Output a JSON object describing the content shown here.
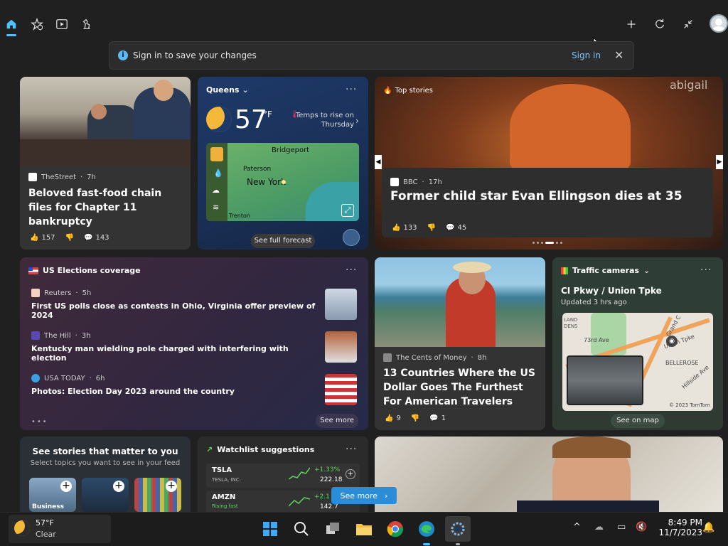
{
  "notice": {
    "message": "Sign in to save your changes",
    "action": "Sign in"
  },
  "card_business": {
    "source": "TheStreet",
    "age": "7h",
    "headline": "Beloved fast-food chain files for Chapter 11 bankruptcy",
    "likes": "157",
    "comments": "143"
  },
  "weather": {
    "location": "Queens",
    "temp": "57",
    "unit": "°F",
    "note": "Temps to rise on Thursday",
    "map_labels": [
      "Bridgeport",
      "Paterson",
      "New York",
      "Trenton"
    ],
    "footer": "See full forecast"
  },
  "top_stories": {
    "label": "Top stories",
    "source": "BBC",
    "age": "17h",
    "headline": "Former child star Evan Ellingson dies at 35",
    "likes": "133",
    "comments": "45",
    "watermark": "abigail"
  },
  "elections": {
    "title": "US Elections coverage",
    "items": [
      {
        "source": "Reuters",
        "age": "5h",
        "headline": "First US polls close as contests in Ohio, Virginia offer preview of 2024"
      },
      {
        "source": "The Hill",
        "age": "3h",
        "headline": "Kentucky man wielding pole charged with interfering with election"
      },
      {
        "source": "USA TODAY",
        "age": "6h",
        "headline": "Photos: Election Day 2023 around the country"
      }
    ],
    "see_more": "See more"
  },
  "travel": {
    "source": "The Cents of Money",
    "age": "8h",
    "headline": "13 Countries Where the US Dollar Goes The Furthest For American Travelers",
    "likes": "9",
    "comments": "1"
  },
  "traffic": {
    "title": "Traffic cameras",
    "location": "CI Pkwy / Union Tpke",
    "updated": "Updated 3 hrs ago",
    "map_labels": [
      "LAND DENS",
      "73rd Ave",
      "Union Tpke",
      "BELLEROSE",
      "Hillside Ave",
      "Grand C"
    ],
    "copyright": "© 2023 TomTom",
    "see_on_map": "See on map"
  },
  "topics": {
    "title": "See stories that matter to you",
    "subtitle": "Select topics you want to see in your feed",
    "tiles": [
      "Business",
      "",
      ""
    ]
  },
  "watchlist": {
    "title": "Watchlist suggestions",
    "rows": [
      {
        "symbol": "TSLA",
        "name": "TESLA, INC.",
        "change": "+1.33%",
        "price": "222.18"
      },
      {
        "symbol": "AMZN",
        "name": "Rising fast",
        "change": "+2.1",
        "price": "142.7"
      }
    ],
    "see_more": "See more"
  },
  "taskbar": {
    "temp": "57°F",
    "condition": "Clear",
    "time": "8:49 PM",
    "date": "11/7/2023"
  },
  "colors": {
    "accent": "#4cc2ff",
    "positive": "#5fd35f",
    "bg": "#202020"
  }
}
